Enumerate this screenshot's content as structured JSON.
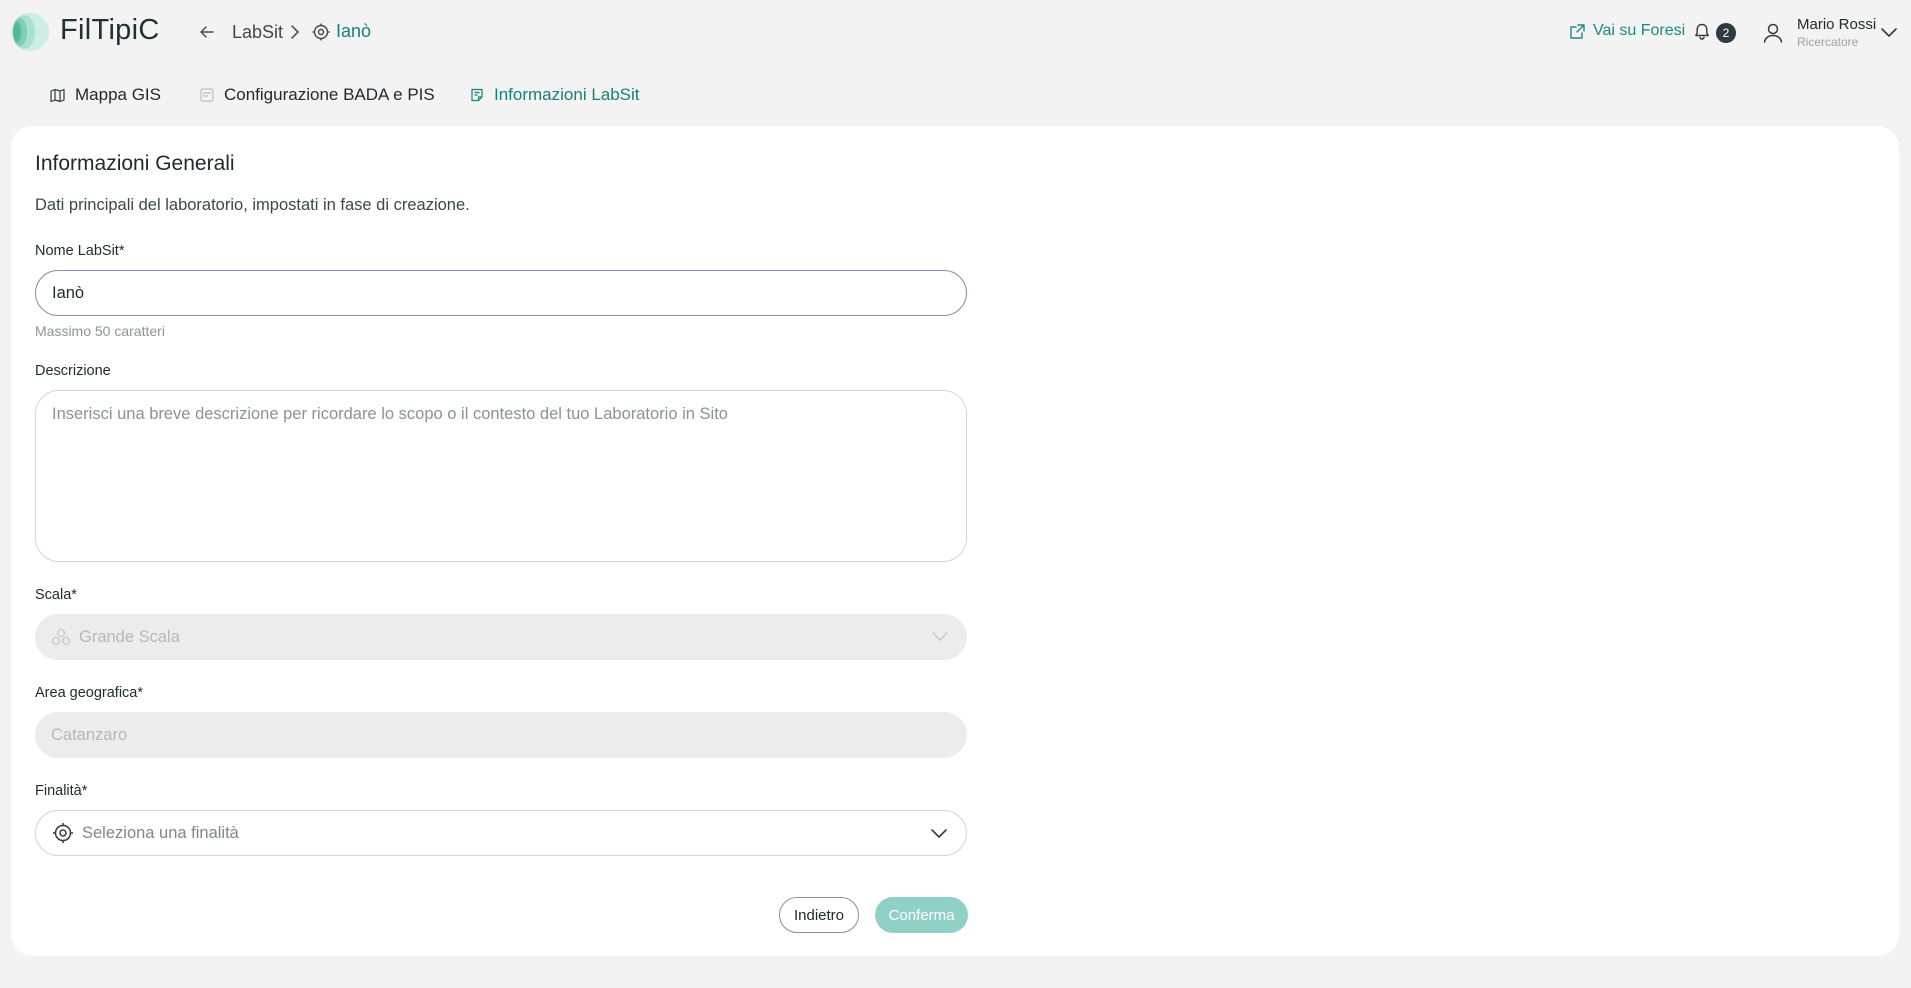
{
  "app": {
    "brand": "FilTipiC",
    "colors": {
      "accent": "#1b7f75",
      "confirm": "#8fd1c6"
    }
  },
  "breadcrumb": {
    "root": "LabSit",
    "current": "Ianò"
  },
  "header": {
    "external_link": "Vai su Foresi",
    "notifications_count": "2",
    "user": {
      "name": "Mario Rossi",
      "role": "Ricercatore"
    }
  },
  "tabs": [
    {
      "label": "Mappa GIS",
      "icon": "map-icon",
      "active": false
    },
    {
      "label": "Configurazione BADA e PIS",
      "icon": "config-icon",
      "active": false
    },
    {
      "label": "Informazioni LabSit",
      "icon": "info-doc-icon",
      "active": true
    }
  ],
  "form": {
    "title": "Informazioni Generali",
    "subtitle": "Dati principali del laboratorio, impostati in fase di creazione.",
    "name": {
      "label": "Nome LabSit*",
      "value": "Ianò",
      "hint": "Massimo 50 caratteri"
    },
    "description": {
      "label": "Descrizione",
      "placeholder": "Inserisci una breve descrizione per ricordare lo scopo o il contesto del tuo Laboratorio in Sito"
    },
    "scale": {
      "label": "Scala*",
      "value": "Grande Scala"
    },
    "area": {
      "label": "Area geografica*",
      "value": "Catanzaro"
    },
    "purpose": {
      "label": "Finalità*",
      "placeholder": "Seleziona una finalità"
    },
    "buttons": {
      "back": "Indietro",
      "confirm": "Conferma"
    }
  }
}
